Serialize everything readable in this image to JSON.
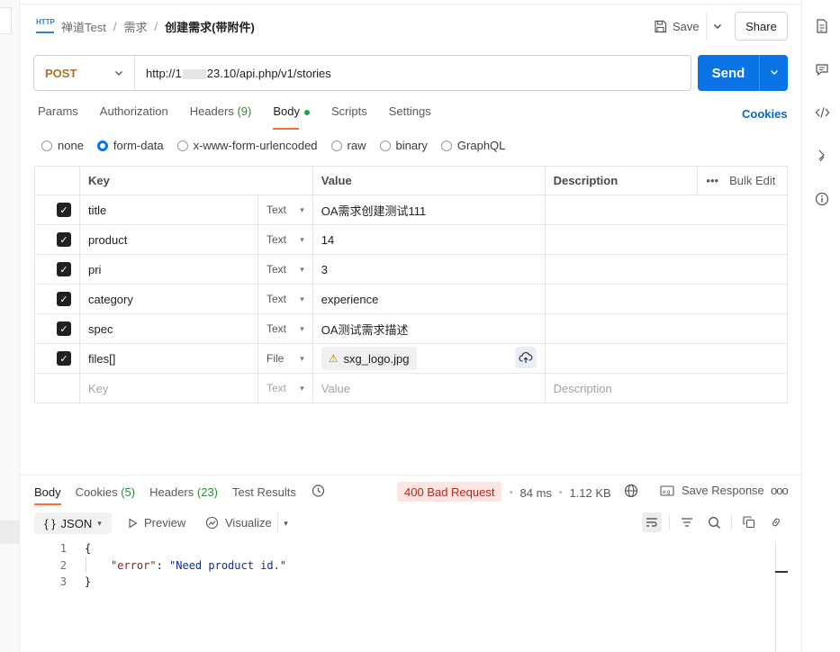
{
  "breadcrumb": {
    "items": [
      "禅道Test",
      "需求"
    ],
    "current": "创建需求(带附件)"
  },
  "header": {
    "save_label": "Save",
    "share_label": "Share"
  },
  "request": {
    "method": "POST",
    "url_prefix": "http://1",
    "url_suffix": "23.10/api.php/v1/stories",
    "send_label": "Send"
  },
  "tabs": {
    "params": "Params",
    "authorization": "Authorization",
    "headers": "Headers",
    "headers_count": "(9)",
    "body": "Body",
    "scripts": "Scripts",
    "settings": "Settings",
    "cookies": "Cookies"
  },
  "body_types": {
    "none": "none",
    "form_data": "form-data",
    "urlencoded": "x-www-form-urlencoded",
    "raw": "raw",
    "binary": "binary",
    "graphql": "GraphQL"
  },
  "table": {
    "headers": {
      "key": "Key",
      "value": "Value",
      "description": "Description",
      "bulk_edit": "Bulk Edit"
    },
    "rows": [
      {
        "key": "title",
        "type": "Text",
        "value": "OA需求创建测试111"
      },
      {
        "key": "product",
        "type": "Text",
        "value": "14"
      },
      {
        "key": "pri",
        "type": "Text",
        "value": "3"
      },
      {
        "key": "category",
        "type": "Text",
        "value": "experience"
      },
      {
        "key": "spec",
        "type": "Text",
        "value": "OA测试需求描述"
      },
      {
        "key": "files[]",
        "type": "File",
        "value": "sxg_logo.jpg"
      }
    ],
    "placeholder": {
      "key": "Key",
      "type": "Text",
      "value": "Value",
      "description": "Description"
    }
  },
  "response": {
    "tabs": {
      "body": "Body",
      "cookies": "Cookies",
      "cookies_count": "(5)",
      "headers": "Headers",
      "headers_count": "(23)",
      "test_results": "Test Results"
    },
    "status": "400 Bad Request",
    "time": "84 ms",
    "size": "1.12 KB",
    "save_response": "Save Response",
    "format": "JSON",
    "preview": "Preview",
    "visualize": "Visualize",
    "code": {
      "line_numbers": [
        "1",
        "2",
        "3"
      ],
      "open": "{",
      "key": "\"error\"",
      "colon": ": ",
      "value": "\"Need product id.\"",
      "close": "}"
    }
  },
  "colors": {
    "accent": "#0a73e6",
    "method": "#b0712a",
    "tab_underline": "#ff6c37",
    "status_bg": "#fde5e3",
    "status_fg": "#b32a1c"
  },
  "icons": {
    "request_type": "http-icon",
    "save": "save-icon",
    "right_bar": [
      "documentation-icon",
      "comments-icon",
      "code-icon",
      "related-collections-icon",
      "info-icon"
    ]
  }
}
